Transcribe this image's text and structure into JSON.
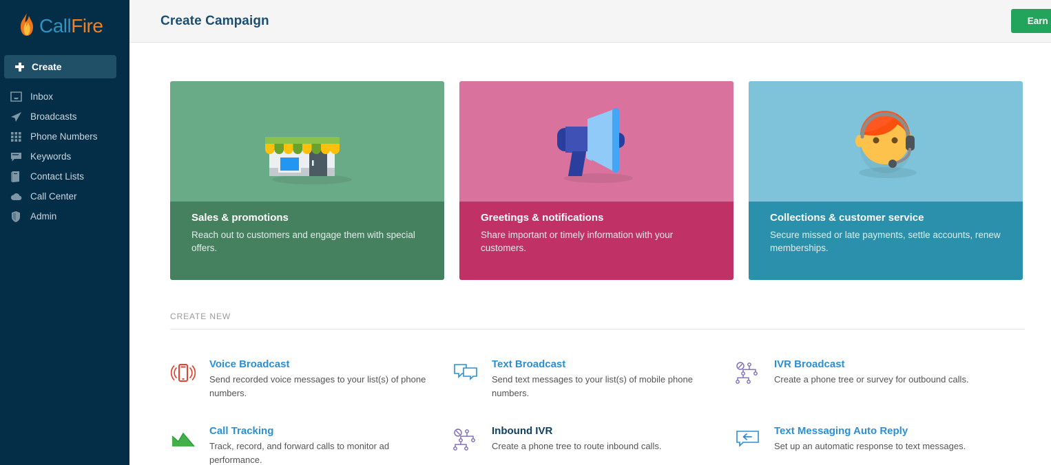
{
  "brand": {
    "logo_call": "Call",
    "logo_fire": "Fire",
    "flame_icon": "flame-icon",
    "accent_blue": "#2f93c0",
    "accent_orange": "#f08123",
    "sidebar_bg": "#042e47"
  },
  "sidebar": {
    "create_label": "Create",
    "items": [
      {
        "label": "Inbox",
        "icon": "inbox-icon"
      },
      {
        "label": "Broadcasts",
        "icon": "paper-plane-icon"
      },
      {
        "label": "Phone Numbers",
        "icon": "grid-icon"
      },
      {
        "label": "Keywords",
        "icon": "speech-bubble-icon"
      },
      {
        "label": "Contact Lists",
        "icon": "book-icon"
      },
      {
        "label": "Call Center",
        "icon": "headset-cloud-icon"
      },
      {
        "label": "Admin",
        "icon": "shield-icon"
      }
    ]
  },
  "header": {
    "title": "Create Campaign",
    "earn_credits_label": "Earn Credits",
    "earn_credits_color": "#22a45d"
  },
  "cards": [
    {
      "title": "Sales & promotions",
      "desc": "Reach out to customers and engage them with special offers.",
      "art": "storefront-illustration",
      "art_bg": "#6aab87",
      "foot_bg": "#46815f"
    },
    {
      "title": "Greetings & notifications",
      "desc": "Share important or timely information with your customers.",
      "art": "megaphone-illustration",
      "art_bg": "#d9739d",
      "foot_bg": "#c03266"
    },
    {
      "title": "Collections & customer service",
      "desc": "Secure missed or late payments, settle accounts, renew memberships.",
      "art": "headset-agent-illustration",
      "art_bg": "#7ec3d9",
      "foot_bg": "#2a90ab"
    }
  ],
  "create_new": {
    "section_label": "CREATE NEW",
    "options": [
      {
        "title": "Voice Broadcast",
        "desc": "Send recorded voice messages to your list(s) of phone numbers.",
        "icon": "phone-waves-icon",
        "visited": false
      },
      {
        "title": "Text Broadcast",
        "desc": "Send text messages to your list(s) of mobile phone numbers.",
        "icon": "two-speech-bubbles-icon",
        "visited": false
      },
      {
        "title": "IVR Broadcast",
        "desc": "Create a phone tree or survey for outbound calls.",
        "icon": "phone-tree-icon",
        "visited": false
      },
      {
        "title": "Call Tracking",
        "desc": "Track, record, and forward calls to monitor ad performance.",
        "icon": "area-chart-icon",
        "visited": false
      },
      {
        "title": "Inbound IVR",
        "desc": "Create a phone tree to route inbound calls.",
        "icon": "phone-tree-icon",
        "visited": true
      },
      {
        "title": "Text Messaging Auto Reply",
        "desc": "Set up an automatic response to text messages.",
        "icon": "reply-bubble-icon",
        "visited": false
      }
    ]
  }
}
